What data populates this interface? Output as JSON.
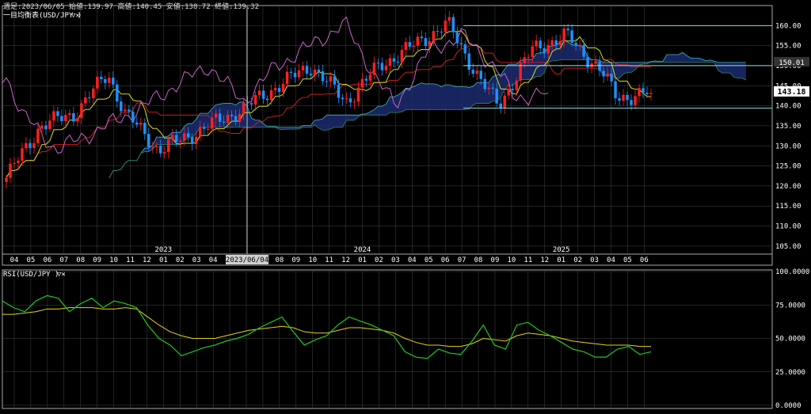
{
  "header": {
    "info": "週足:2023/06/05 始値:139.97 高値:140.45 安値:138.72 終値:139.32",
    "indicator_label": "一目均衡表(USD/JPY )",
    "rsi_label": "RSI(USD/JPY )"
  },
  "cursor_date": "2023/06/04",
  "current_price": "143.18",
  "price_badge": "150.01",
  "price_axis": {
    "min": 103,
    "max": 165,
    "ticks": [
      "160.00",
      "155.00",
      "150.00",
      "145.00",
      "140.00",
      "135.00",
      "130.00",
      "125.00",
      "120.00",
      "115.00",
      "110.00",
      "105.00"
    ]
  },
  "rsi_axis": {
    "min": 0,
    "max": 100,
    "ticks": [
      "100.0000",
      "75.0000",
      "50.0000",
      "25.0000",
      "0.0000"
    ]
  },
  "time_axis": {
    "months": [
      "04",
      "05",
      "06",
      "07",
      "08",
      "09",
      "10",
      "11",
      "12",
      "01",
      "02",
      "03",
      "04",
      "05",
      "06",
      "07",
      "08",
      "09",
      "10",
      "11",
      "12",
      "01",
      "02",
      "03",
      "04",
      "05",
      "06",
      "07",
      "08",
      "09",
      "10",
      "11",
      "12",
      "01",
      "02",
      "03",
      "04",
      "05",
      "06"
    ],
    "years": [
      {
        "label": "2023",
        "index": 9
      },
      {
        "label": "2024",
        "index": 21
      },
      {
        "label": "2025",
        "index": 33
      }
    ]
  },
  "colors": {
    "up": "#ff2020",
    "down": "#1e90ff",
    "tenkan": "#d9d91a",
    "kijun": "#c81e1e",
    "chikou": "#c864c8",
    "cloud_fill": "#1c2a6e",
    "cloud_line": "#3fb8c8",
    "rsi": "#22c722",
    "rsi_signal": "#e6d21e",
    "grid": "#444444",
    "hline": "#8fe0e8"
  },
  "chart_data": [
    {
      "type": "candlestick",
      "title": "一目均衡表(USD/JPY )",
      "x_range": [
        "2022-04",
        "2025-06"
      ],
      "ylim": [
        103,
        165
      ],
      "key_closes": [
        {
          "date": "2022-04",
          "value": 122
        },
        {
          "date": "2022-06",
          "value": 135
        },
        {
          "date": "2022-08",
          "value": 138
        },
        {
          "date": "2022-10",
          "value": 148
        },
        {
          "date": "2022-11",
          "value": 138
        },
        {
          "date": "2023-01",
          "value": 129
        },
        {
          "date": "2023-03",
          "value": 133
        },
        {
          "date": "2023-06",
          "value": 139.32
        },
        {
          "date": "2023-08",
          "value": 145
        },
        {
          "date": "2023-10",
          "value": 150
        },
        {
          "date": "2023-12",
          "value": 141
        },
        {
          "date": "2024-02",
          "value": 150
        },
        {
          "date": "2024-04",
          "value": 155
        },
        {
          "date": "2024-06",
          "value": 160.5
        },
        {
          "date": "2024-08",
          "value": 146
        },
        {
          "date": "2024-09",
          "value": 140
        },
        {
          "date": "2024-11",
          "value": 154
        },
        {
          "date": "2025-01",
          "value": 157.5
        },
        {
          "date": "2025-03",
          "value": 149
        },
        {
          "date": "2025-04",
          "value": 142
        },
        {
          "date": "2025-06",
          "value": 143.18
        }
      ],
      "horizontal_lines": [
        160.0,
        150.01,
        139.4
      ]
    },
    {
      "type": "line",
      "title": "RSI(USD/JPY )",
      "ylim": [
        0,
        100
      ],
      "series": [
        {
          "values": [
            78,
            73,
            70,
            78,
            82,
            80,
            70,
            76,
            80,
            73,
            78,
            76,
            73,
            60,
            50,
            45,
            37,
            40,
            43,
            45,
            48,
            50,
            53,
            58,
            62,
            66,
            55,
            45,
            49,
            52,
            60,
            66,
            63,
            60,
            56,
            52,
            40,
            36,
            35,
            42,
            39,
            38,
            48,
            60,
            45,
            42,
            60,
            62,
            56,
            52,
            47,
            42,
            40,
            36,
            36,
            42,
            44,
            38,
            40
          ]
        },
        {
          "values": [
            68,
            68,
            69,
            70,
            72,
            72,
            73,
            73,
            73,
            72,
            72,
            73,
            72,
            66,
            60,
            55,
            52,
            50,
            50,
            50,
            52,
            54,
            56,
            57,
            58,
            59,
            58,
            55,
            54,
            54,
            56,
            58,
            58,
            57,
            56,
            54,
            50,
            47,
            45,
            45,
            44,
            44,
            46,
            50,
            49,
            48,
            52,
            54,
            53,
            52,
            50,
            48,
            47,
            46,
            45,
            45,
            45,
            44,
            44
          ]
        }
      ]
    }
  ]
}
